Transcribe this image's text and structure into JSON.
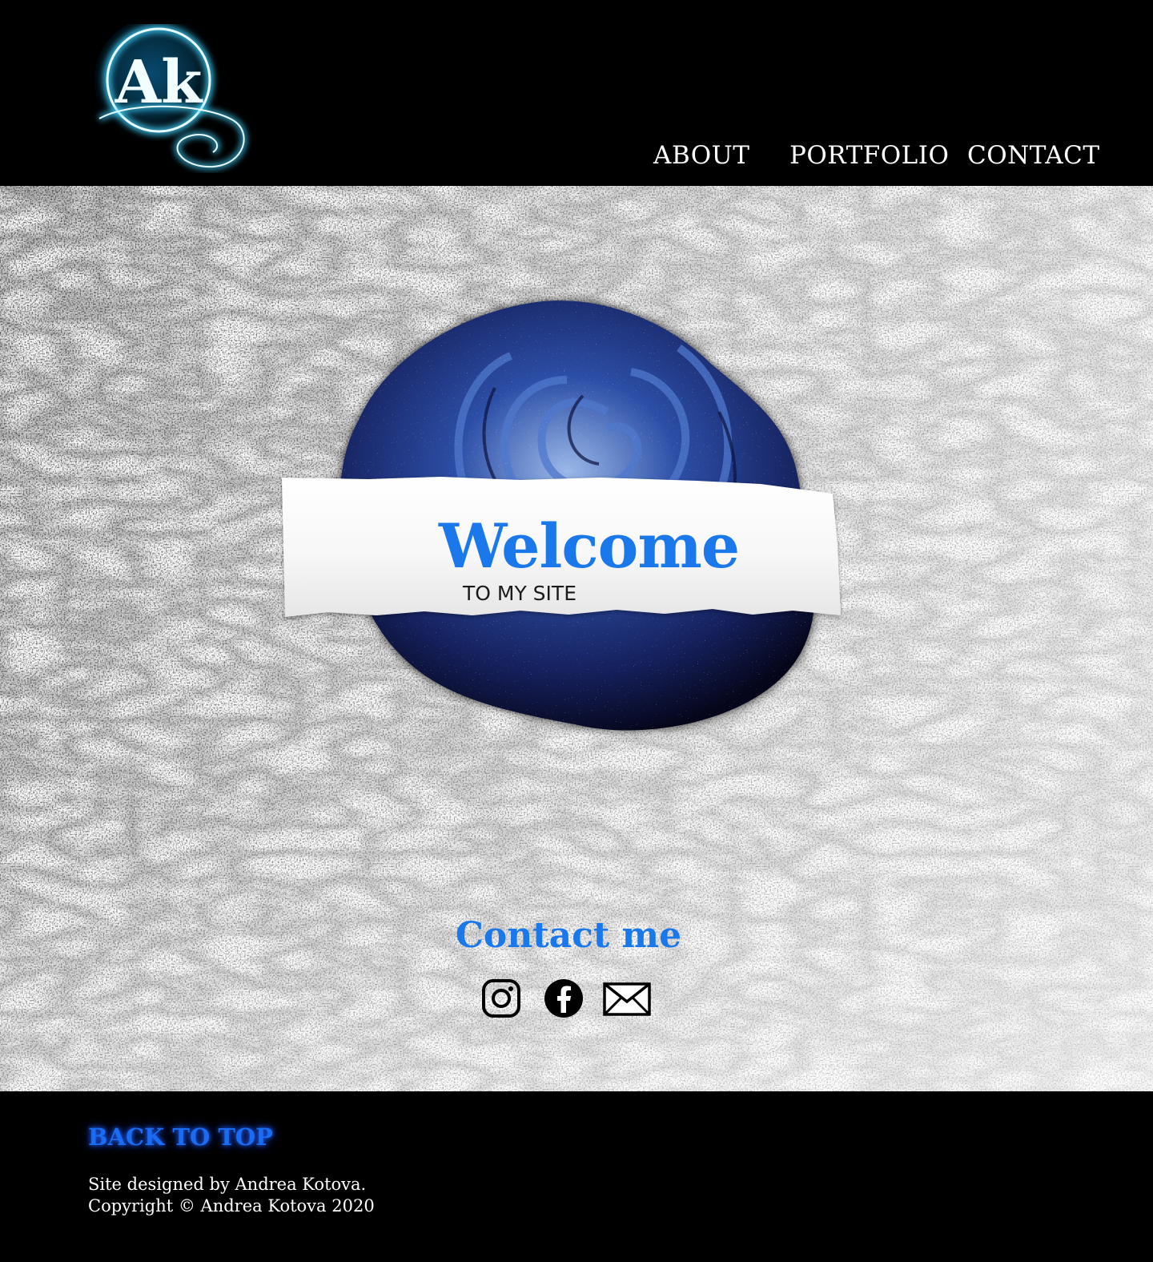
{
  "header": {
    "logo_text": "Ak",
    "nav": {
      "about": "ABOUT",
      "portfolio": "PORTFOLIO",
      "contact": "CONTACT"
    }
  },
  "hero": {
    "title": "Welcome",
    "subtitle": "TO MY SITE"
  },
  "contact": {
    "heading": "Contact me",
    "icons": [
      "instagram-icon",
      "facebook-icon",
      "mail-icon"
    ]
  },
  "footer": {
    "back_to_top": "BACK TO TOP",
    "designed_by": "Site designed by Andrea Kotova.",
    "copyright": "Copyright © Andrea Kotova 2020"
  },
  "colors": {
    "accent": "#1a78ea",
    "background_dark": "#000000",
    "rose": "#1b2f7a"
  }
}
